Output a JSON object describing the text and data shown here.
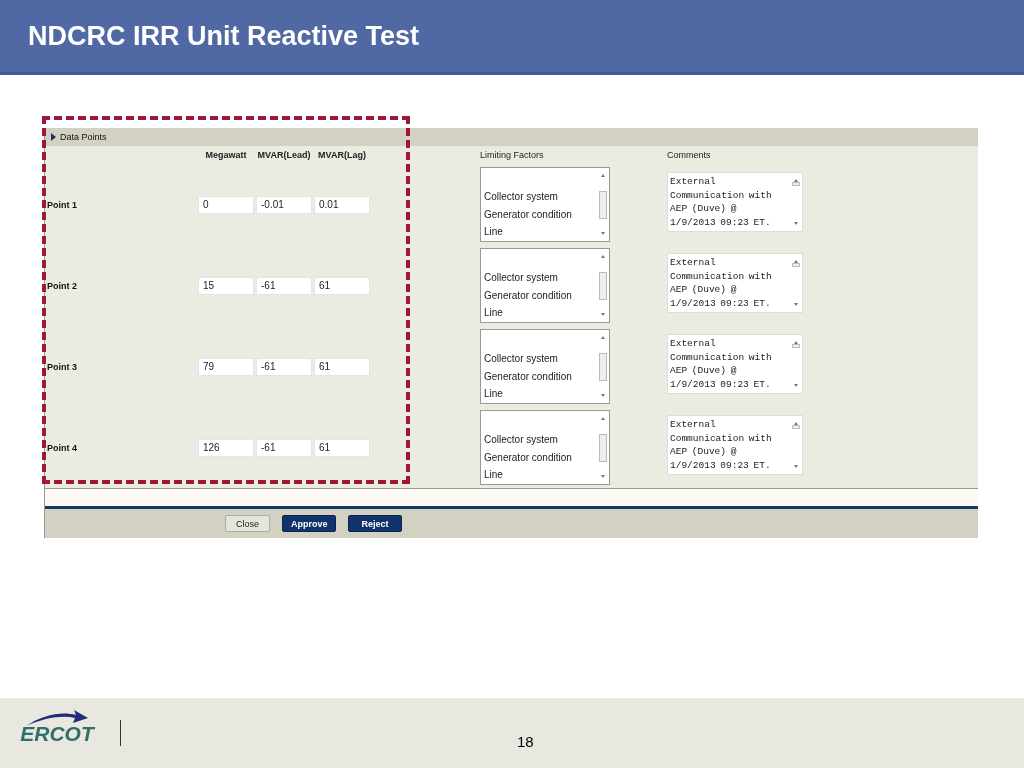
{
  "slide": {
    "title": "NDCRC IRR Unit Reactive Test"
  },
  "panel": {
    "section_label": "Data Points",
    "columns": [
      "Megawatt",
      "MVAR(Lead)",
      "MVAR(Lag)"
    ],
    "limiting_label": "Limiting Factors",
    "comments_label": "Comments",
    "points": [
      {
        "label": "Point 1",
        "values": [
          "0",
          "-0.01",
          "0.01"
        ],
        "limiting_factors": [
          "Collector system",
          "Generator condition",
          "Line"
        ],
        "comment": "External Communication with AEP (Duve) @ 1/9/2013 09:23 ET."
      },
      {
        "label": "Point 2",
        "values": [
          "15",
          "-61",
          "61"
        ],
        "limiting_factors": [
          "Collector system",
          "Generator condition",
          "Line"
        ],
        "comment": "External Communication with AEP (Duve) @ 1/9/2013 09:23 ET."
      },
      {
        "label": "Point 3",
        "values": [
          "79",
          "-61",
          "61"
        ],
        "limiting_factors": [
          "Collector system",
          "Generator condition",
          "Line"
        ],
        "comment": "External Communication with AEP (Duve) @ 1/9/2013 09:23 ET."
      },
      {
        "label": "Point 4",
        "values": [
          "126",
          "-61",
          "61"
        ],
        "limiting_factors": [
          "Collector system",
          "Generator condition",
          "Line"
        ],
        "comment": "External Communication with AEP (Duve) @ 1/9/2013 09:23 ET."
      }
    ],
    "buttons": [
      {
        "label": "Close",
        "kind": "secondary"
      },
      {
        "label": "Approve",
        "kind": "primary"
      },
      {
        "label": "Reject",
        "kind": "primary"
      }
    ]
  },
  "footer": {
    "logo": "ERCOT",
    "page_number": "18"
  }
}
